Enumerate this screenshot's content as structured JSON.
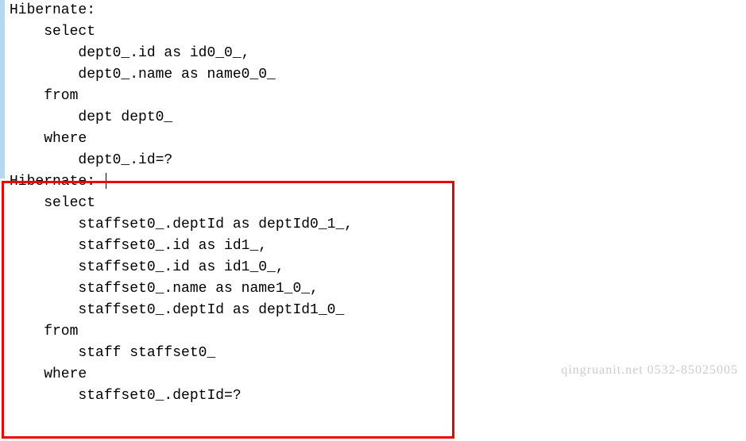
{
  "query1": {
    "label": "Hibernate:",
    "select_kw": "    select",
    "col1": "        dept0_.id as id0_0_,",
    "col2": "        dept0_.name as name0_0_ ",
    "from_kw": "    from",
    "table": "        dept dept0_ ",
    "where_kw": "    where",
    "cond": "        dept0_.id=?"
  },
  "query2": {
    "label": "Hibernate: ",
    "select_kw": "    select",
    "col1": "        staffset0_.deptId as deptId0_1_,",
    "col2": "        staffset0_.id as id1_,",
    "col3": "        staffset0_.id as id1_0_,",
    "col4": "        staffset0_.name as name1_0_,",
    "col5": "        staffset0_.deptId as deptId1_0_ ",
    "from_kw": "    from",
    "table": "        staff staffset0_ ",
    "where_kw": "    where",
    "cond": "        staffset0_.deptId=?"
  },
  "watermark": "qingruanit.net 0532-85025005"
}
